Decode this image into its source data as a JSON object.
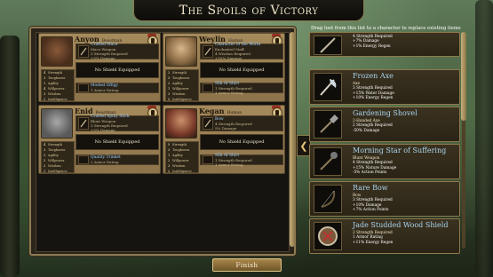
{
  "title": "The Spoils of Victory",
  "hint": "Drag loot from this list to a character to replace existing items",
  "stat_labels": [
    "Strength",
    "Toughness",
    "Agility",
    "Willpower",
    "Wisdom",
    "Intelligence"
  ],
  "characters": [
    {
      "name": "Anyon",
      "race": "Beastman",
      "stats": [
        "4",
        "3",
        "1",
        "4",
        "3",
        "2"
      ],
      "weapon": {
        "name": "Crafted Mace",
        "lines": [
          "Mace Weapon",
          "3 Strength Required",
          "+5% Damage"
        ]
      },
      "shield": "No Shield Equipped",
      "armor": {
        "name": "Modest Effigy",
        "lines": [
          "1 Armor Rating"
        ]
      }
    },
    {
      "name": "Weylin",
      "race": "Human",
      "stats": [
        "2",
        "3",
        "2",
        "1",
        "3",
        "5"
      ],
      "weapon": {
        "name": "Character of the Worm",
        "lines": [
          "Enchanted Staff",
          "4 Wisdom Required",
          "+10% Damage"
        ]
      },
      "shield": "No Shield Equipped",
      "armor": {
        "name": "Silk Af Shirt",
        "lines": [
          "1 Strength Required",
          "1 Armor Rating"
        ]
      }
    },
    {
      "name": "Enid",
      "race": "Beastman",
      "stats": [
        "4",
        "3",
        "2",
        "3",
        "2",
        "2"
      ],
      "weapon": {
        "name": "Crafted Spiny Stick",
        "lines": [
          "Blunt Weapon",
          "3 Strength Required",
          "+5% Damage"
        ]
      },
      "shield": "No Shield Equipped",
      "armor": {
        "name": "Quality Trinket",
        "lines": [
          "2 Armor Rating"
        ]
      }
    },
    {
      "name": "Kegan",
      "race": "Human",
      "stats": [
        "5",
        "3",
        "1",
        "2",
        "3",
        "2"
      ],
      "weapon": {
        "name": "Bow",
        "lines": [
          "4 Strength Required",
          "5% Damage"
        ]
      },
      "shield": "No Shield Equipped",
      "armor": {
        "name": "Silk Af Shirt",
        "lines": [
          "1 Strength Required",
          "1 Armor Rating"
        ]
      }
    }
  ],
  "loot": [
    {
      "name": "",
      "lines": [
        "4 Strength Required",
        "+7% Damage",
        "+1% Energy Regen"
      ]
    },
    {
      "name": "Frozen Axe",
      "lines": [
        "Axe",
        "3 Strength Required",
        "+15% Water Damage",
        "+10% Energy Regen"
      ]
    },
    {
      "name": "Gardening Shovel",
      "lines": [
        "2-Handed Axe",
        "2 Strength Required",
        "-50% Damage"
      ]
    },
    {
      "name": "Morning Star of Suffering",
      "lines": [
        "Blunt Weapon",
        "4 Strength Required",
        "+15% Nature Damage",
        "-5% Action Points"
      ]
    },
    {
      "name": "Rare Bow",
      "lines": [
        "Bow",
        "3 Strength Required",
        "+10% Damage",
        "+7% Action Points"
      ]
    },
    {
      "name": "Jade Studded Wood Shield",
      "lines": [
        "2 Strength Required",
        "1 Armor Rating",
        "+11% Energy Regen"
      ]
    }
  ],
  "finish_label": "Finish",
  "colors": {
    "item_name": "#a9d4ee",
    "panel_border": "#8d7a52",
    "card_bg": "#a58a5c"
  }
}
